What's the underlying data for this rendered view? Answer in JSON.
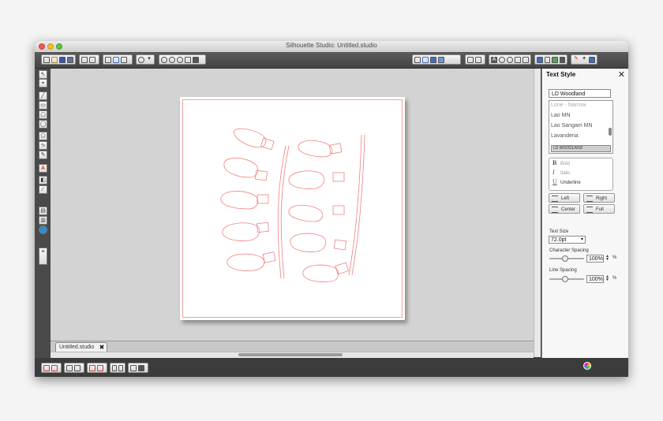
{
  "window": {
    "title": "Silhouette Studio: Untitled.studio"
  },
  "document_tab": {
    "label": "Untitled.studio",
    "close_glyph": "✖"
  },
  "text_panel": {
    "title": "Text Style",
    "close_glyph": "✕",
    "font_input_value": "LD Woodland",
    "font_list": [
      "Lone - Narrow",
      "Lao MN",
      "Lao Sangam MN",
      "Lavanderia"
    ],
    "font_selected_preview": "LD WOODLAND",
    "styles": {
      "bold": "Bold",
      "italic": "Italic",
      "underline": "Underline"
    },
    "style_glyphs": {
      "bold": "B",
      "italic": "I",
      "underline": "U"
    },
    "align": {
      "left": "Left",
      "right": "Right",
      "center": "Center",
      "full": "Full"
    },
    "text_size_label": "Text Size",
    "text_size_value": "72.0pt",
    "char_spacing_label": "Character Spacing",
    "char_spacing_value": "100%",
    "line_spacing_label": "Line Spacing",
    "line_spacing_value": "100%",
    "percent_unit": "%"
  },
  "colors": {
    "cut_line": "#f08080",
    "workspace": "#d3d3d3",
    "chrome_dark": "#3c3c3c",
    "accent_red_icon": "#d33"
  },
  "icons": {
    "toolbar": [
      "new-file-icon",
      "open-icon",
      "save-icon",
      "print-icon",
      "cut-send-icon",
      "undo-icon",
      "redo-icon",
      "zoom-in-icon",
      "zoom-out-icon",
      "pan-hand-icon",
      "fit-page-icon",
      "grid-icon",
      "page-setup-icon",
      "cut-settings-icon",
      "text-style-icon",
      "fill-color-icon",
      "line-color-icon",
      "library-icon",
      "store-icon"
    ],
    "left_tools": [
      "select-icon",
      "point-edit-icon",
      "line-icon",
      "rectangle-icon",
      "rounded-rect-icon",
      "ellipse-icon",
      "polygon-icon",
      "curve-icon",
      "freehand-icon",
      "text-icon",
      "eraser-icon",
      "knife-icon"
    ]
  }
}
